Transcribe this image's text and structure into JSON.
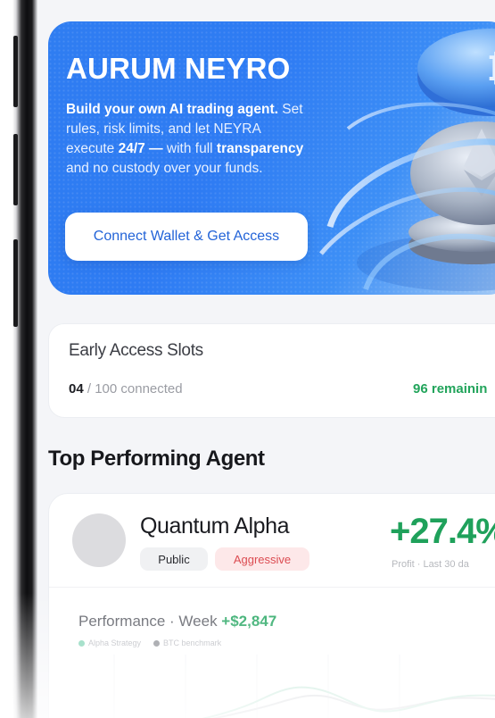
{
  "hero": {
    "title": "AURUM NEYRO",
    "desc_b1": "Build your own AI trading agent.",
    "desc_t1": " Set rules, risk limits, and let NEYRA execute ",
    "desc_b2": "24/7 —",
    "desc_t2": " with full ",
    "desc_b3": "transparency",
    "desc_t3": " and no custody over your funds.",
    "cta_label": "Connect Wallet & Get Access"
  },
  "early_access": {
    "title": "Early Access Slots",
    "connected": "04",
    "total": "/ 100 connected",
    "remaining": "96 remainin",
    "connected_count": 4,
    "total_count": 100
  },
  "top_agent": {
    "section_title": "Top Performing Agent",
    "name": "Quantum Alpha",
    "tag_public": "Public",
    "tag_risk": "Aggressive",
    "profit": "+27.4%",
    "profit_sub": "Profit · Last 30 da",
    "perf_label": "Performance · Week ",
    "perf_value": "+$2,847",
    "legend_strategy": "Alpha Strategy",
    "legend_benchmark": "BTC benchmark"
  },
  "colors": {
    "accent_blue": "#2f7df1",
    "profit_green": "#1fa15b",
    "risk_red": "#dc4c52",
    "strategy_line": "#7fd3b4",
    "benchmark_line": "#c9cbd0"
  },
  "icons": {
    "hero_art": "crypto-coins-rings-illustration"
  }
}
